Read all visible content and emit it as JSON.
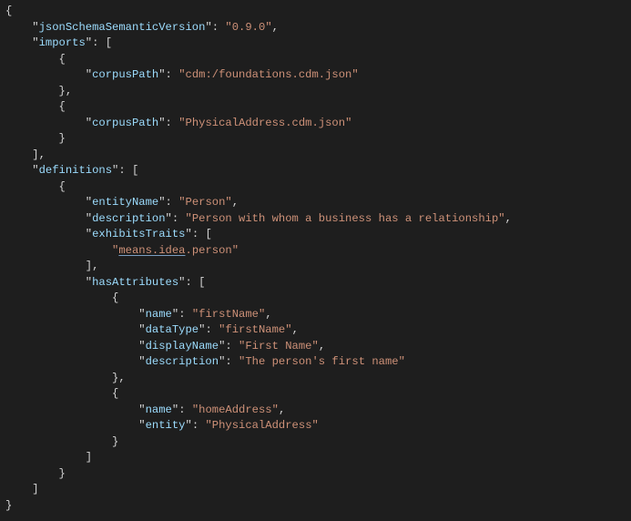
{
  "code": {
    "jsonSchemaSemanticVersion": {
      "key": "jsonSchemaSemanticVersion",
      "value": "0.9.0"
    },
    "imports": {
      "key": "imports",
      "items": [
        {
          "corpusPath_key": "corpusPath",
          "corpusPath_value": "cdm:/foundations.cdm.json"
        },
        {
          "corpusPath_key": "corpusPath",
          "corpusPath_value": "PhysicalAddress.cdm.json"
        }
      ]
    },
    "definitions": {
      "key": "definitions",
      "entityName": {
        "key": "entityName",
        "value": "Person"
      },
      "description": {
        "key": "description",
        "value": "Person with whom a business has a relationship"
      },
      "exhibitsTraits": {
        "key": "exhibitsTraits",
        "trait_prefix": "means.idea",
        "trait_suffix": ".person"
      },
      "hasAttributes": {
        "key": "hasAttributes",
        "attr1": {
          "name": {
            "key": "name",
            "value": "firstName"
          },
          "dataType": {
            "key": "dataType",
            "value": "firstName"
          },
          "displayName": {
            "key": "displayName",
            "value": "First Name"
          },
          "description": {
            "key": "description",
            "value": "The person's first name"
          }
        },
        "attr2": {
          "name": {
            "key": "name",
            "value": "homeAddress"
          },
          "entity": {
            "key": "entity",
            "value": "PhysicalAddress"
          }
        }
      }
    }
  }
}
